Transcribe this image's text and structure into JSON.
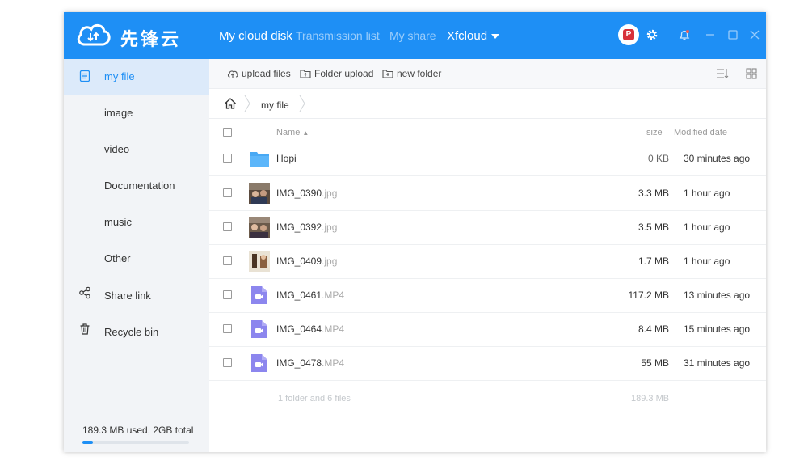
{
  "app": {
    "name": "先锋云",
    "tabs": [
      {
        "label": "My cloud disk"
      },
      {
        "label": "Transmission list"
      },
      {
        "label": "My share"
      }
    ],
    "cloud_menu": "Xfcloud"
  },
  "sidebar": {
    "items": [
      {
        "label": "my file",
        "icon": "document-icon"
      },
      {
        "label": "image"
      },
      {
        "label": "video"
      },
      {
        "label": "Documentation"
      },
      {
        "label": "music"
      },
      {
        "label": "Other"
      },
      {
        "label": "Share link",
        "icon": "share-icon"
      },
      {
        "label": "Recycle bin",
        "icon": "trash-icon"
      }
    ],
    "storage_text": "189.3 MB used, 2GB total",
    "storage_fraction": 0.095
  },
  "toolbar": {
    "upload_files": "upload files",
    "folder_upload": "Folder upload",
    "new_folder": "new folder"
  },
  "breadcrumb": {
    "current": "my file"
  },
  "list": {
    "headers": {
      "name": "Name",
      "size": "size",
      "modified": "Modified date"
    },
    "rows": [
      {
        "name": "Hopi",
        "ext": "",
        "size": "0 KB",
        "modified": "30 minutes ago",
        "kind": "folder"
      },
      {
        "name": "IMG_0390",
        "ext": ".jpg",
        "size": "3.3 MB",
        "modified": "1 hour ago",
        "kind": "image"
      },
      {
        "name": "IMG_0392",
        "ext": ".jpg",
        "size": "3.5 MB",
        "modified": "1 hour ago",
        "kind": "image"
      },
      {
        "name": "IMG_0409",
        "ext": ".jpg",
        "size": "1.7 MB",
        "modified": "1 hour ago",
        "kind": "image"
      },
      {
        "name": "IMG_0461",
        "ext": ".MP4",
        "size": "117.2 MB",
        "modified": "13 minutes ago",
        "kind": "video"
      },
      {
        "name": "IMG_0464",
        "ext": ".MP4",
        "size": "8.4 MB",
        "modified": "15 minutes ago",
        "kind": "video"
      },
      {
        "name": "IMG_0478",
        "ext": ".MP4",
        "size": "55 MB",
        "modified": "31 minutes ago",
        "kind": "video"
      }
    ],
    "footer_count": "1 folder and 6 files",
    "footer_size": "189.3 MB"
  },
  "colors": {
    "accent": "#1e8ff5",
    "folder": "#49a9f4",
    "video": "#8c86ee"
  }
}
